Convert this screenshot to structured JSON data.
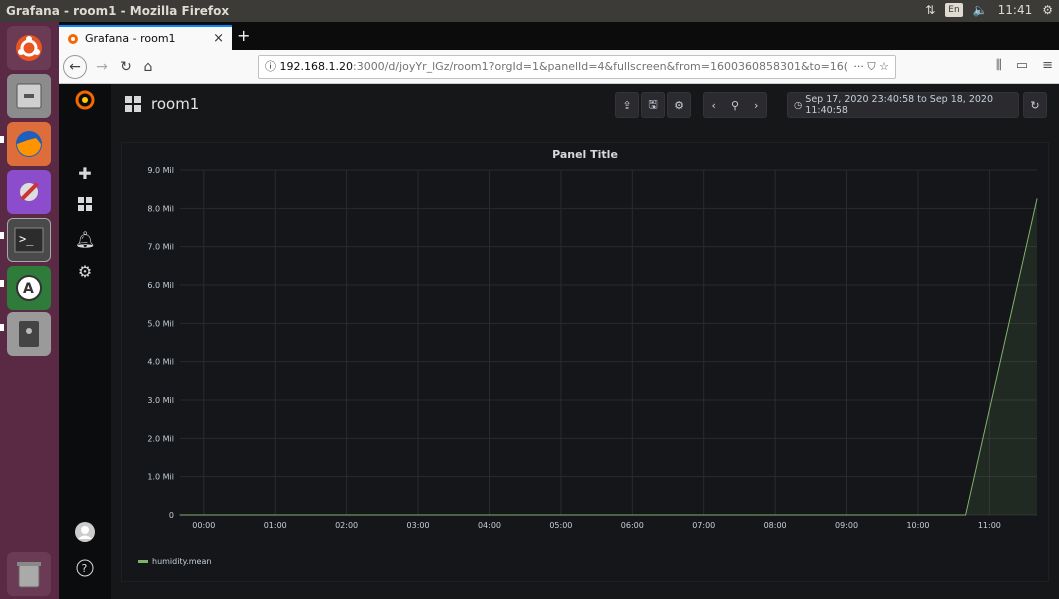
{
  "os": {
    "window_title": "Grafana - room1 - Mozilla Firefox",
    "keyboard_layout": "En",
    "clock": "11:41"
  },
  "browser": {
    "tab_title": "Grafana - room1",
    "url_host": "192.168.1.20",
    "url_rest": ":3000/d/joyYr_lGz/room1?orgId=1&panelId=4&fullscreen&from=1600360858301&to=16("
  },
  "grafana": {
    "dashboard_title": "room1",
    "time_range": "Sep 17, 2020 23:40:58 to Sep 18, 2020 11:40:58",
    "colors": {
      "accent": "#1f78c1",
      "series": "#7eb26d",
      "brand": "#f46800"
    }
  },
  "chart_data": {
    "type": "area",
    "title": "Panel Title",
    "xlabel": "",
    "ylabel": "",
    "x_ticks": [
      "00:00",
      "01:00",
      "02:00",
      "03:00",
      "04:00",
      "05:00",
      "06:00",
      "07:00",
      "08:00",
      "09:00",
      "10:00",
      "11:00"
    ],
    "y_ticks": [
      "0",
      "1.0 Mil",
      "2.0 Mil",
      "3.0 Mil",
      "4.0 Mil",
      "5.0 Mil",
      "6.0 Mil",
      "7.0 Mil",
      "8.0 Mil",
      "9.0 Mil"
    ],
    "ylim": [
      0,
      9000000
    ],
    "grid": true,
    "legend_position": "bottom-left",
    "series": [
      {
        "name": "humidity.mean",
        "points": [
          {
            "x": "23:40",
            "y": 0
          },
          {
            "x": "10:40",
            "y": 0
          },
          {
            "x": "11:40",
            "y": 8250000
          }
        ]
      }
    ]
  }
}
